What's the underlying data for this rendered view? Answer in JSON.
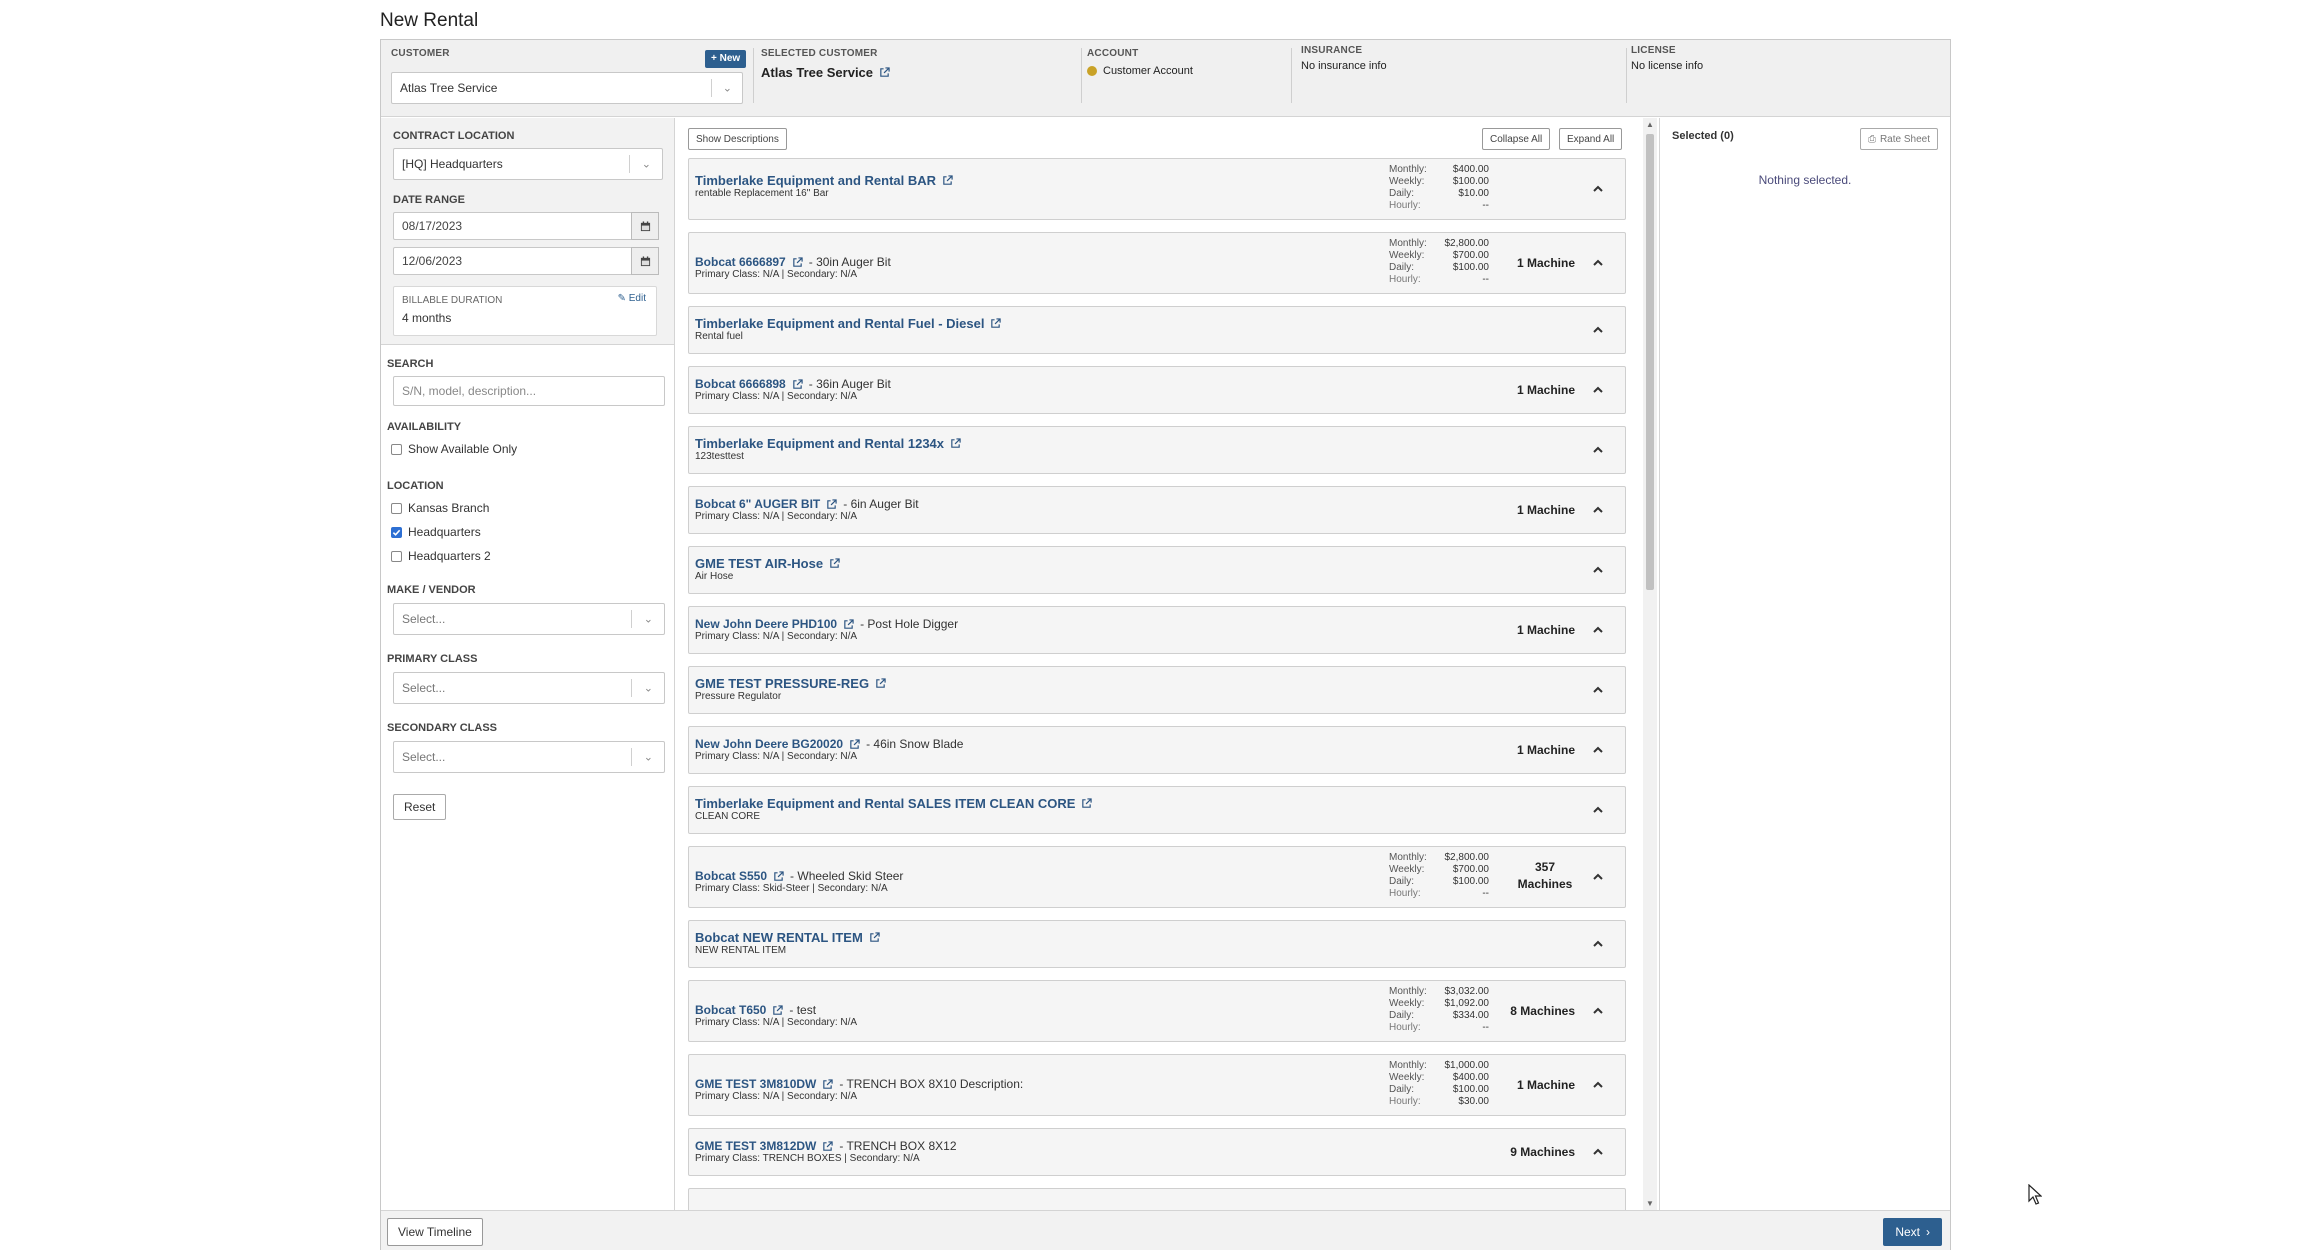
{
  "page": {
    "title": "New Rental"
  },
  "header": {
    "customer_label": "CUSTOMER",
    "new_button": "+ New",
    "customer_value": "Atlas Tree Service",
    "selected_customer_label": "SELECTED CUSTOMER",
    "selected_customer_value": "Atlas Tree Service",
    "account_label": "ACCOUNT",
    "account_value": "Customer Account",
    "insurance_label": "INSURANCE",
    "insurance_value": "No insurance info",
    "license_label": "LICENSE",
    "license_value": "No license info"
  },
  "filters": {
    "contract_location_label": "CONTRACT LOCATION",
    "contract_location_value": "[HQ] Headquarters",
    "date_range_label": "DATE RANGE",
    "start_date": "08/17/2023",
    "end_date": "12/06/2023",
    "billable_duration_label": "BILLABLE DURATION",
    "billable_duration_value": "4 months",
    "edit_label": "Edit",
    "search_label": "SEARCH",
    "search_placeholder": "S/N, model, description...",
    "availability_label": "AVAILABILITY",
    "show_available_only": "Show Available Only",
    "location_label": "LOCATION",
    "locations": [
      {
        "label": "Kansas Branch",
        "checked": false
      },
      {
        "label": "Headquarters",
        "checked": true
      },
      {
        "label": "Headquarters 2",
        "checked": false
      }
    ],
    "make_vendor_label": "MAKE / VENDOR",
    "primary_class_label": "PRIMARY CLASS",
    "secondary_class_label": "SECONDARY CLASS",
    "select_placeholder": "Select...",
    "reset_button": "Reset"
  },
  "toolbar": {
    "show_descriptions": "Show Descriptions",
    "collapse_all": "Collapse All",
    "expand_all": "Expand All"
  },
  "items": [
    {
      "title": "Timberlake Equipment and Rental BAR",
      "suffix": "",
      "sub": "rentable Replacement 16\" Bar",
      "rates": [
        "$400.00",
        "$100.00",
        "$10.00",
        "--"
      ],
      "machines": ""
    },
    {
      "title": "Bobcat 6666897",
      "suffix": "- 30in Auger Bit",
      "sub": "Primary Class: N/A | Secondary: N/A",
      "rates": [
        "$2,800.00",
        "$700.00",
        "$100.00",
        "--"
      ],
      "machines": "1 Machine"
    },
    {
      "title": "Timberlake Equipment and Rental Fuel - Diesel",
      "suffix": "",
      "sub": "Rental fuel",
      "rates": null,
      "machines": ""
    },
    {
      "title": "Bobcat 6666898",
      "suffix": "- 36in Auger Bit",
      "sub": "Primary Class: N/A | Secondary: N/A",
      "rates": null,
      "machines": "1 Machine"
    },
    {
      "title": "Timberlake Equipment and Rental 1234x",
      "suffix": "",
      "sub": "123testtest",
      "rates": null,
      "machines": ""
    },
    {
      "title": "Bobcat 6\" AUGER BIT",
      "suffix": "- 6in Auger Bit",
      "sub": "Primary Class: N/A | Secondary: N/A",
      "rates": null,
      "machines": "1 Machine"
    },
    {
      "title": "GME TEST AIR-Hose",
      "suffix": "",
      "sub": "Air Hose",
      "rates": null,
      "machines": ""
    },
    {
      "title": "New John Deere PHD100",
      "suffix": "- Post Hole Digger",
      "sub": "Primary Class: N/A | Secondary: N/A",
      "rates": null,
      "machines": "1 Machine"
    },
    {
      "title": "GME TEST PRESSURE-REG",
      "suffix": "",
      "sub": "Pressure Regulator",
      "rates": null,
      "machines": ""
    },
    {
      "title": "New John Deere BG20020",
      "suffix": "- 46in Snow Blade",
      "sub": "Primary Class: N/A | Secondary: N/A",
      "rates": null,
      "machines": "1 Machine"
    },
    {
      "title": "Timberlake Equipment and Rental SALES ITEM CLEAN CORE",
      "suffix": "",
      "sub": "CLEAN CORE",
      "rates": null,
      "machines": ""
    },
    {
      "title": "Bobcat S550",
      "suffix": "- Wheeled Skid Steer",
      "sub": "Primary Class: Skid-Steer | Secondary: N/A",
      "rates": [
        "$2,800.00",
        "$700.00",
        "$100.00",
        "--"
      ],
      "machines": "357 Machines"
    },
    {
      "title": "Bobcat NEW RENTAL ITEM",
      "suffix": "",
      "sub": "NEW RENTAL ITEM",
      "rates": null,
      "machines": ""
    },
    {
      "title": "Bobcat T650",
      "suffix": "- test",
      "sub": "Primary Class: N/A | Secondary: N/A",
      "rates": [
        "$3,032.00",
        "$1,092.00",
        "$334.00",
        "--"
      ],
      "machines": "8 Machines"
    },
    {
      "title": "GME TEST 3M810DW",
      "suffix": "- TRENCH BOX 8X10 Description:",
      "sub": "Primary Class: N/A | Secondary: N/A",
      "rates": [
        "$1,000.00",
        "$400.00",
        "$100.00",
        "$30.00"
      ],
      "machines": "1 Machine"
    },
    {
      "title": "GME TEST 3M812DW",
      "suffix": "- TRENCH BOX 8X12",
      "sub": "Primary Class: TRENCH BOXES | Secondary: N/A",
      "rates": null,
      "machines": "9 Machines"
    }
  ],
  "rate_labels": [
    "Monthly:",
    "Weekly:",
    "Daily:",
    "Hourly:"
  ],
  "selected": {
    "title": "Selected (0)",
    "rate_sheet": "Rate Sheet",
    "empty_text": "Nothing selected."
  },
  "footer": {
    "view_timeline": "View Timeline",
    "next": "Next"
  },
  "colors": {
    "accent": "#2d5f8f",
    "link": "#2c5582",
    "checkbox": "#2d6fd3"
  }
}
